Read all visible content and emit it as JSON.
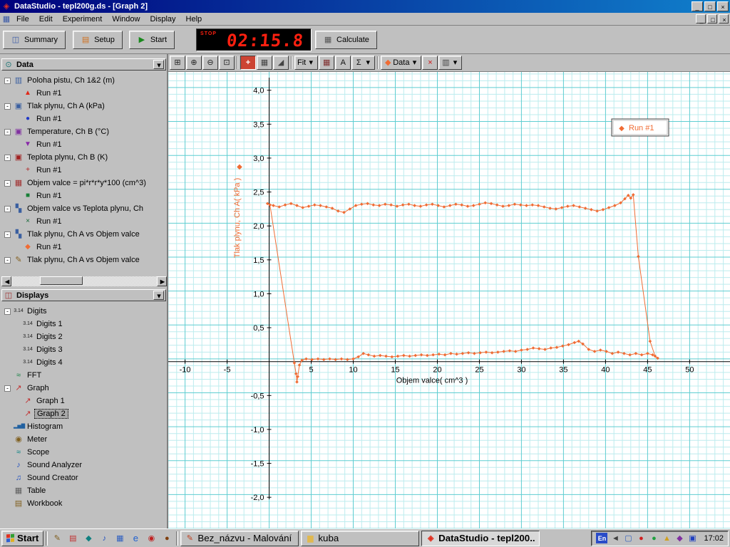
{
  "titlebar": {
    "title": "DataStudio - tepl200g.ds - [Graph 2]"
  },
  "menubar": {
    "items": [
      "File",
      "Edit",
      "Experiment",
      "Window",
      "Display",
      "Help"
    ]
  },
  "toolbar": {
    "summary": "Summary",
    "setup": "Setup",
    "start": "Start",
    "calculate": "Calculate",
    "timer": {
      "stop": "STOP",
      "value": "02:15.8"
    }
  },
  "graph_toolbar": {
    "fit": "Fit",
    "data": "Data"
  },
  "data_panel": {
    "title": "Data",
    "items": [
      {
        "icon": "position-sensor-icon",
        "label": "Poloha pistu, Ch 1&2 (m)",
        "runs": [
          {
            "marker": "triangle-red",
            "label": "Run #1"
          }
        ]
      },
      {
        "icon": "pressure-sensor-icon",
        "label": "Tlak plynu, Ch A (kPa)",
        "runs": [
          {
            "marker": "circle-blue",
            "label": "Run #1"
          }
        ]
      },
      {
        "icon": "temperature-sensor-icon",
        "label": "Temperature, Ch B (°C)",
        "runs": [
          {
            "marker": "triangle-purple",
            "label": "Run #1"
          }
        ]
      },
      {
        "icon": "gas-temp-sensor-icon",
        "label": "Teplota plynu, Ch B (K)",
        "runs": [
          {
            "marker": "plus-red",
            "label": "Run #1"
          }
        ]
      },
      {
        "icon": "calc-data-icon",
        "label": "Objem valce = pi*r*r*y*100 (cm^3)",
        "runs": [
          {
            "marker": "square-green",
            "label": "Run #1"
          }
        ]
      },
      {
        "icon": "xy-data-icon",
        "label": "Objem valce vs Teplota plynu, Ch",
        "runs": [
          {
            "marker": "x-green",
            "label": "Run #1"
          }
        ]
      },
      {
        "icon": "xy-data-icon",
        "label": "Tlak plynu, Ch A vs Objem valce",
        "runs": [
          {
            "marker": "diamond-orange",
            "label": "Run #1"
          }
        ]
      },
      {
        "icon": "pen-icon",
        "label": "Tlak plynu, Ch A vs Objem valce",
        "runs": []
      }
    ]
  },
  "displays_panel": {
    "title": "Displays",
    "items": [
      {
        "icon": "digits-icon",
        "label": "Digits",
        "children": [
          {
            "icon": "digits-icon",
            "label": "Digits 1"
          },
          {
            "icon": "digits-icon",
            "label": "Digits 2"
          },
          {
            "icon": "digits-icon",
            "label": "Digits 3"
          },
          {
            "icon": "digits-icon",
            "label": "Digits 4"
          }
        ]
      },
      {
        "icon": "fft-icon",
        "label": "FFT"
      },
      {
        "icon": "graph-icon",
        "label": "Graph",
        "children": [
          {
            "icon": "graph-icon",
            "label": "Graph 1"
          },
          {
            "icon": "graph-icon",
            "label": "Graph 2",
            "selected": true
          }
        ]
      },
      {
        "icon": "histogram-icon",
        "label": "Histogram"
      },
      {
        "icon": "meter-icon",
        "label": "Meter"
      },
      {
        "icon": "scope-icon",
        "label": "Scope"
      },
      {
        "icon": "sound-analyzer-icon",
        "label": "Sound Analyzer"
      },
      {
        "icon": "sound-creator-icon",
        "label": "Sound Creator"
      },
      {
        "icon": "table-icon",
        "label": "Table"
      },
      {
        "icon": "workbook-icon",
        "label": "Workbook"
      }
    ]
  },
  "chart_data": {
    "type": "scatter",
    "title": "",
    "xlabel": "Objem valce( cm^3 )",
    "ylabel": "Tlak plynu, Ch A( kPa )",
    "xlim": [
      -12,
      54.8
    ],
    "ylim": [
      -2.46,
      4.27
    ],
    "x_minor": 1,
    "x_major": 5,
    "y_minor": 0.1,
    "y_major": 0.5,
    "grid": true,
    "background": "#ffffff",
    "grid_minor_color": "#bdecee",
    "grid_major_color": "#5fcdd1",
    "axis_color": "#000000",
    "x_ticks": [
      {
        "v": -10,
        "label": "-10"
      },
      {
        "v": -5,
        "label": "-5"
      },
      {
        "v": 5,
        "label": "5"
      },
      {
        "v": 10,
        "label": "10"
      },
      {
        "v": 15,
        "label": "15"
      },
      {
        "v": 20,
        "label": "20"
      },
      {
        "v": 25,
        "label": "25"
      },
      {
        "v": 30,
        "label": "30"
      },
      {
        "v": 35,
        "label": "35"
      },
      {
        "v": 40,
        "label": "40"
      },
      {
        "v": 45,
        "label": "45"
      },
      {
        "v": 50,
        "label": "50"
      }
    ],
    "y_ticks": [
      {
        "v": 4.0,
        "label": "4,0"
      },
      {
        "v": 3.5,
        "label": "3,5"
      },
      {
        "v": 3.0,
        "label": "3,0"
      },
      {
        "v": 2.5,
        "label": "2,5"
      },
      {
        "v": 2.0,
        "label": "2,0"
      },
      {
        "v": 1.5,
        "label": "1,5"
      },
      {
        "v": 1.0,
        "label": "1,0"
      },
      {
        "v": 0.5,
        "label": "0,5"
      },
      {
        "v": -0.5,
        "label": "-0,5"
      },
      {
        "v": -1.0,
        "label": "-1,0"
      },
      {
        "v": -1.5,
        "label": "-1,5"
      },
      {
        "v": -2.0,
        "label": "-2,0"
      }
    ],
    "legend": {
      "position": "top-right",
      "entries": [
        "Run #1"
      ]
    },
    "series": [
      {
        "name": "Run #1",
        "color": "#f06c34",
        "marker": "diamond",
        "points": [
          [
            -0.2,
            2.33
          ],
          [
            0.5,
            2.3
          ],
          [
            1.2,
            2.28
          ],
          [
            1.9,
            2.31
          ],
          [
            2.6,
            2.33
          ],
          [
            3.3,
            2.3
          ],
          [
            4.0,
            2.27
          ],
          [
            4.7,
            2.29
          ],
          [
            5.4,
            2.31
          ],
          [
            6.1,
            2.3
          ],
          [
            6.8,
            2.28
          ],
          [
            7.5,
            2.26
          ],
          [
            8.2,
            2.22
          ],
          [
            8.9,
            2.2
          ],
          [
            9.6,
            2.25
          ],
          [
            10.3,
            2.3
          ],
          [
            11.0,
            2.32
          ],
          [
            11.7,
            2.33
          ],
          [
            12.4,
            2.31
          ],
          [
            13.1,
            2.3
          ],
          [
            13.8,
            2.32
          ],
          [
            14.5,
            2.31
          ],
          [
            15.2,
            2.29
          ],
          [
            15.9,
            2.31
          ],
          [
            16.6,
            2.32
          ],
          [
            17.3,
            2.3
          ],
          [
            18.0,
            2.29
          ],
          [
            18.7,
            2.31
          ],
          [
            19.4,
            2.32
          ],
          [
            20.1,
            2.3
          ],
          [
            20.8,
            2.28
          ],
          [
            21.5,
            2.3
          ],
          [
            22.2,
            2.32
          ],
          [
            22.9,
            2.31
          ],
          [
            23.6,
            2.29
          ],
          [
            24.3,
            2.3
          ],
          [
            25.0,
            2.32
          ],
          [
            25.7,
            2.34
          ],
          [
            26.4,
            2.33
          ],
          [
            27.1,
            2.31
          ],
          [
            27.8,
            2.29
          ],
          [
            28.5,
            2.3
          ],
          [
            29.2,
            2.32
          ],
          [
            29.9,
            2.31
          ],
          [
            30.6,
            2.3
          ],
          [
            31.3,
            2.31
          ],
          [
            32.0,
            2.3
          ],
          [
            32.7,
            2.28
          ],
          [
            33.4,
            2.26
          ],
          [
            34.1,
            2.25
          ],
          [
            34.8,
            2.27
          ],
          [
            35.5,
            2.29
          ],
          [
            36.2,
            2.3
          ],
          [
            36.9,
            2.28
          ],
          [
            37.6,
            2.26
          ],
          [
            38.3,
            2.24
          ],
          [
            39.0,
            2.22
          ],
          [
            39.7,
            2.24
          ],
          [
            40.4,
            2.27
          ],
          [
            41.1,
            2.3
          ],
          [
            41.8,
            2.34
          ],
          [
            42.3,
            2.4
          ],
          [
            42.7,
            2.45
          ],
          [
            43.0,
            2.41
          ],
          [
            43.3,
            2.46
          ],
          [
            43.9,
            1.55
          ],
          [
            45.3,
            0.3
          ],
          [
            45.9,
            0.08
          ],
          [
            46.2,
            0.05
          ],
          [
            45.6,
            0.1
          ],
          [
            45.0,
            0.12
          ],
          [
            44.3,
            0.1
          ],
          [
            43.6,
            0.12
          ],
          [
            42.9,
            0.1
          ],
          [
            42.2,
            0.12
          ],
          [
            41.5,
            0.14
          ],
          [
            40.8,
            0.12
          ],
          [
            40.1,
            0.15
          ],
          [
            39.4,
            0.17
          ],
          [
            38.7,
            0.15
          ],
          [
            38.0,
            0.18
          ],
          [
            37.3,
            0.26
          ],
          [
            36.8,
            0.3
          ],
          [
            36.3,
            0.28
          ],
          [
            35.6,
            0.25
          ],
          [
            34.9,
            0.23
          ],
          [
            34.2,
            0.21
          ],
          [
            33.5,
            0.2
          ],
          [
            32.8,
            0.18
          ],
          [
            32.1,
            0.19
          ],
          [
            31.4,
            0.2
          ],
          [
            30.7,
            0.18
          ],
          [
            30.0,
            0.17
          ],
          [
            29.3,
            0.15
          ],
          [
            28.6,
            0.16
          ],
          [
            27.9,
            0.15
          ],
          [
            27.2,
            0.14
          ],
          [
            26.5,
            0.13
          ],
          [
            25.8,
            0.14
          ],
          [
            25.1,
            0.13
          ],
          [
            24.4,
            0.12
          ],
          [
            23.7,
            0.13
          ],
          [
            23.0,
            0.12
          ],
          [
            22.3,
            0.11
          ],
          [
            21.6,
            0.12
          ],
          [
            20.9,
            0.1
          ],
          [
            20.2,
            0.11
          ],
          [
            19.5,
            0.1
          ],
          [
            18.8,
            0.09
          ],
          [
            18.1,
            0.1
          ],
          [
            17.4,
            0.09
          ],
          [
            16.7,
            0.08
          ],
          [
            16.0,
            0.09
          ],
          [
            15.3,
            0.08
          ],
          [
            14.6,
            0.07
          ],
          [
            13.9,
            0.08
          ],
          [
            13.2,
            0.09
          ],
          [
            12.5,
            0.08
          ],
          [
            11.8,
            0.1
          ],
          [
            11.2,
            0.12
          ],
          [
            10.6,
            0.07
          ],
          [
            10.0,
            0.04
          ],
          [
            9.3,
            0.03
          ],
          [
            8.6,
            0.04
          ],
          [
            7.9,
            0.03
          ],
          [
            7.2,
            0.04
          ],
          [
            6.5,
            0.03
          ],
          [
            5.8,
            0.04
          ],
          [
            5.1,
            0.03
          ],
          [
            4.4,
            0.04
          ],
          [
            3.9,
            0.02
          ],
          [
            3.6,
            -0.05
          ],
          [
            3.4,
            -0.22
          ],
          [
            3.3,
            -0.3
          ],
          [
            3.2,
            -0.18
          ],
          [
            3.0,
            -0.02
          ],
          [
            0.1,
            2.31
          ]
        ]
      }
    ]
  },
  "taskbar": {
    "start_label": "Start",
    "quicklaunch": [
      "ql-notes-icon",
      "ql-doc-icon",
      "ql-media-icon",
      "ql-sound-icon",
      "ql-grid-icon",
      "ie-icon",
      "ql-red-icon",
      "ql-cup-icon"
    ],
    "tasks": [
      {
        "icon": "paint-icon",
        "label": "Bez_názvu - Malování",
        "active": false
      },
      {
        "icon": "folder-icon",
        "label": "kuba",
        "active": false
      },
      {
        "icon": "datastudio-icon",
        "label": "DataStudio - tepl200...",
        "active": true
      }
    ],
    "tray": {
      "lang": "En",
      "icons": [
        "speaker-icon",
        "tray-display-icon",
        "tray-red-icon",
        "tray-green-icon",
        "tray-yellow-icon",
        "tray-purple-icon",
        "tray-blue-icon"
      ],
      "clock": "17:02"
    }
  }
}
